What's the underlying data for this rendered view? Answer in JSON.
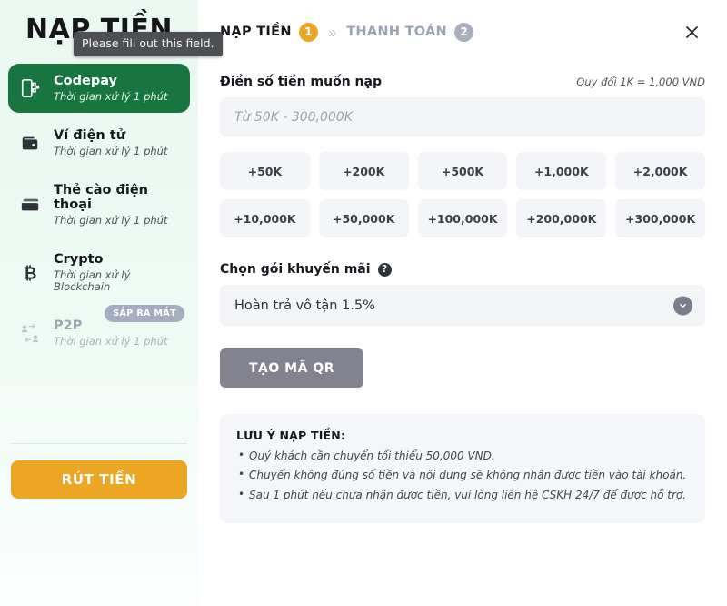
{
  "sidebar": {
    "logo": "NẠP TIỀN",
    "tooltip": "Please fill out this field.",
    "items": [
      {
        "icon": "codepay-qr-icon",
        "title": "Codepay",
        "sub": "Thời gian xử lý 1 phút",
        "active": true,
        "badge": ""
      },
      {
        "icon": "wallet-icon",
        "title": "Ví điện tử",
        "sub": "Thời gian xử lý 1 phút",
        "active": false,
        "badge": ""
      },
      {
        "icon": "credit-card-icon",
        "title": "Thẻ cào điện thoại",
        "sub": "Thời gian xử lý 1 phút",
        "active": false,
        "badge": ""
      },
      {
        "icon": "bitcoin-icon",
        "title": "Crypto",
        "sub": "Thời gian xử lý Blockchain",
        "active": false,
        "badge": ""
      },
      {
        "icon": "p2p-exchange-icon",
        "title": "P2P",
        "sub": "Thời gian xử lý 1 phút",
        "active": false,
        "badge": "SẮP RA MẮT"
      }
    ],
    "withdraw_label": "RÚT TIỀN"
  },
  "steps": [
    {
      "label": "NẠP TIỀN",
      "num": "1",
      "active": true
    },
    {
      "label": "THANH TOÁN",
      "num": "2",
      "active": false
    }
  ],
  "step_separator": "»",
  "close_icon": "close-icon",
  "amount": {
    "label": "Điền số tiền muốn nạp",
    "note": "Quy đổi 1K = 1,000 VND",
    "placeholder": "Từ 50K - 300,000K",
    "value": "",
    "presets": [
      "+50K",
      "+200K",
      "+500K",
      "+1,000K",
      "+2,000K",
      "+10,000K",
      "+50,000K",
      "+100,000K",
      "+200,000K",
      "+300,000K"
    ]
  },
  "promo": {
    "label": "Chọn gói khuyến mãi",
    "help_icon": "help-circle-icon",
    "selected": "Hoàn trả vô tận 1.5%",
    "chevron_icon": "chevron-down-icon"
  },
  "submit_label": "TẠO MÃ QR",
  "notice": {
    "title": "LƯU Ý NẠP TIỀN:",
    "items": [
      "Quý khách cần chuyển tối thiểu 50,000 VND.",
      "Chuyển không đúng số tiền và nội dung sẽ không nhận được tiền vào tài khoản.",
      "Sau 1 phút nếu chưa nhận được tiền, vui lòng liên hệ CSKH 24/7 để được hỗ trợ."
    ]
  },
  "colors": {
    "active_green": "#19753f",
    "accent_orange": "#eda524",
    "step_inactive": "#a9afbe",
    "field_bg": "#f4f5f9",
    "submit_gray": "#82838f",
    "badge_soon": "#a7adc0"
  }
}
